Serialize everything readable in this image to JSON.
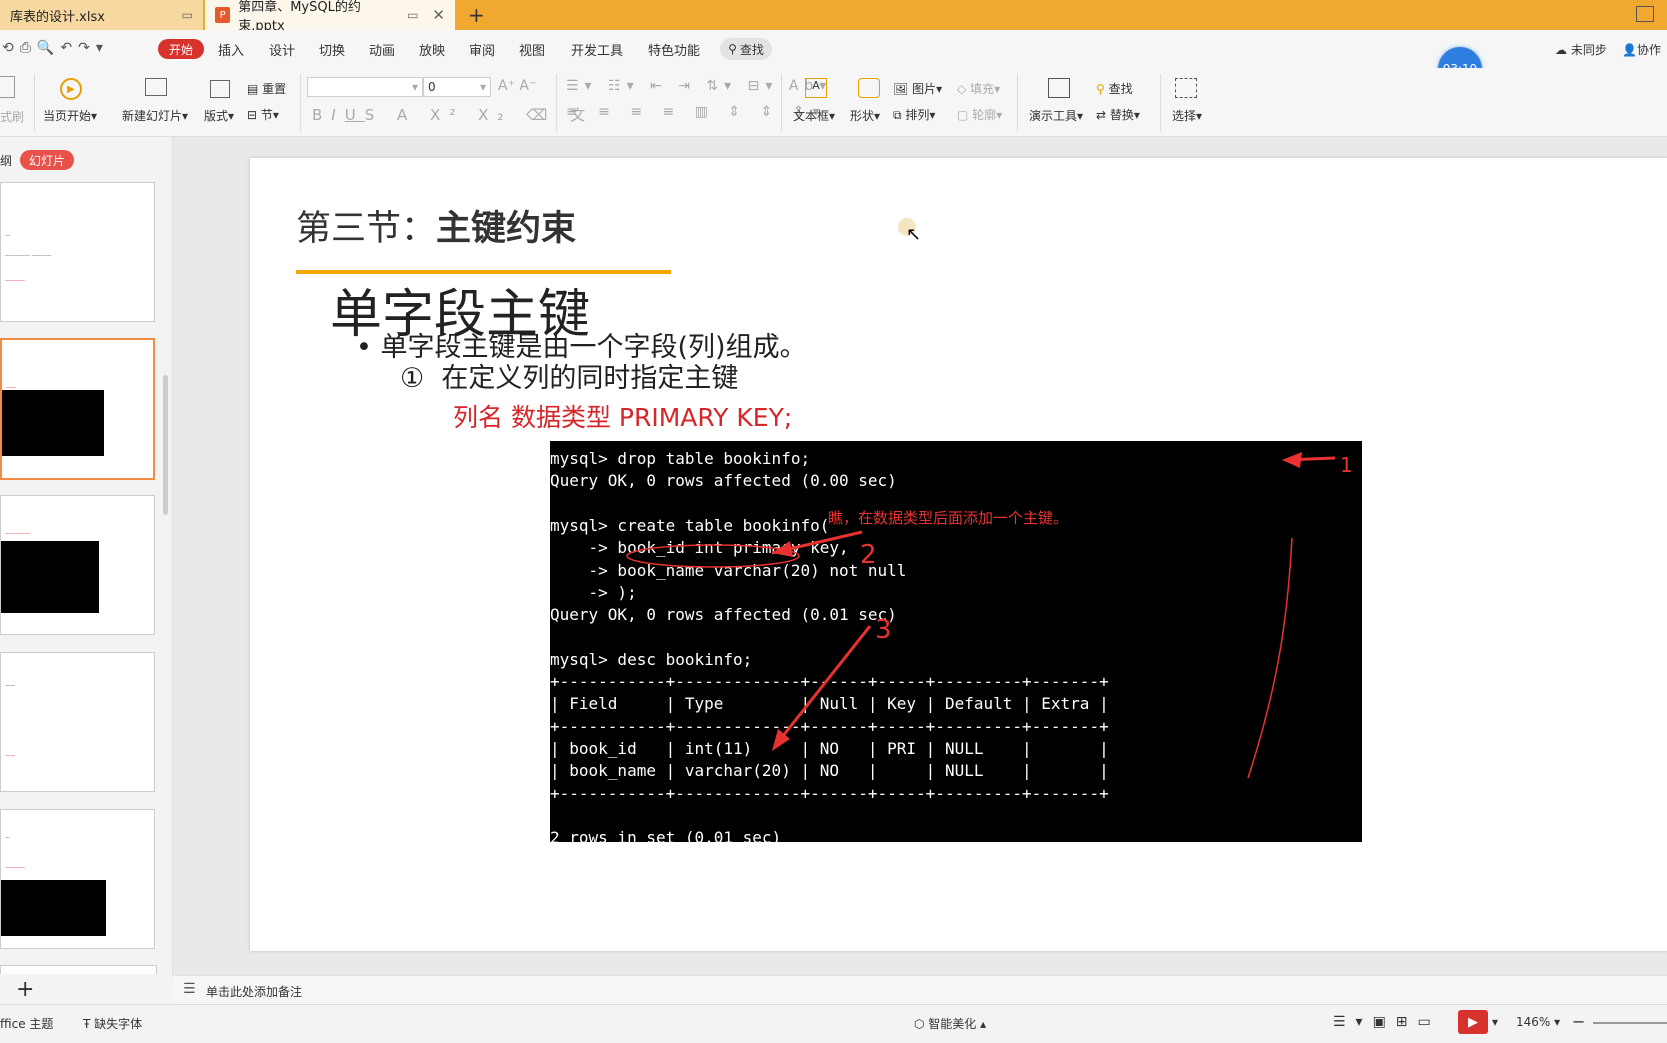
{
  "tabs": [
    {
      "label": "库表的设计.xlsx"
    },
    {
      "label": "第四章、MySQL的约束.pptx"
    }
  ],
  "menu": [
    "开始",
    "插入",
    "设计",
    "切换",
    "动画",
    "放映",
    "审阅",
    "视图",
    "开发工具",
    "特色功能"
  ],
  "search_label": "查找",
  "sync_label": "未同步",
  "collab_label": "协作",
  "timer": "03:19",
  "ribbon": {
    "format_painter": "式刷",
    "from_current": "当页开始",
    "new_slide": "新建幻灯片",
    "layout": "版式",
    "reset": "重置",
    "section": "节",
    "font_size": "0",
    "textbox": "文本框",
    "shape": "形状",
    "picture": "图片",
    "fill": "填充",
    "arrange": "排列",
    "outline": "轮廓",
    "present_tools": "演示工具",
    "find": "查找",
    "replace": "替换",
    "select": "选择"
  },
  "left_panel": {
    "outline_tab": "纲",
    "slide_tab": "幻灯片"
  },
  "slide": {
    "title_prefix": "第三节：",
    "title_bold": "主键约束",
    "heading": "单字段主键",
    "bullet": "单字段主键是由一个字段(列)组成。",
    "sub_number": "①",
    "sub_text": "在定义列的同时指定主键",
    "syntax": "列名  数据类型  PRIMARY KEY;"
  },
  "terminal": {
    "lines": [
      "mysql> drop table bookinfo;",
      "Query OK, 0 rows affected (0.00 sec)",
      "",
      "mysql> create table bookinfo(",
      "    -> book_id int primary key,",
      "    -> book_name varchar(20) not null",
      "    -> );",
      "Query OK, 0 rows affected (0.01 sec)",
      "",
      "mysql> desc bookinfo;",
      "+-----------+-------------+------+-----+---------+-------+",
      "| Field     | Type        | Null | Key | Default | Extra |",
      "+-----------+-------------+------+-----+---------+-------+",
      "| book_id   | int(11)     | NO   | PRI | NULL    |       |",
      "| book_name | varchar(20) | NO   |     | NULL    |       |",
      "+-----------+-------------+------+-----+---------+-------+",
      "",
      "2 rows in set (0.01 sec)"
    ],
    "annotation": "瞧，在数据类型后面添加一个主键。",
    "marks": [
      "1",
      "2",
      "3"
    ]
  },
  "notes_placeholder": "单击此处添加备注",
  "status": {
    "theme": "ffice 主题",
    "missing_font": "缺失字体",
    "beautify": "智能美化",
    "zoom": "146%"
  },
  "colors": {
    "tabbar": "#f0a830",
    "accent_red": "#d7322c",
    "orange_line": "#f0a800",
    "syntax_red": "#d6262a"
  }
}
